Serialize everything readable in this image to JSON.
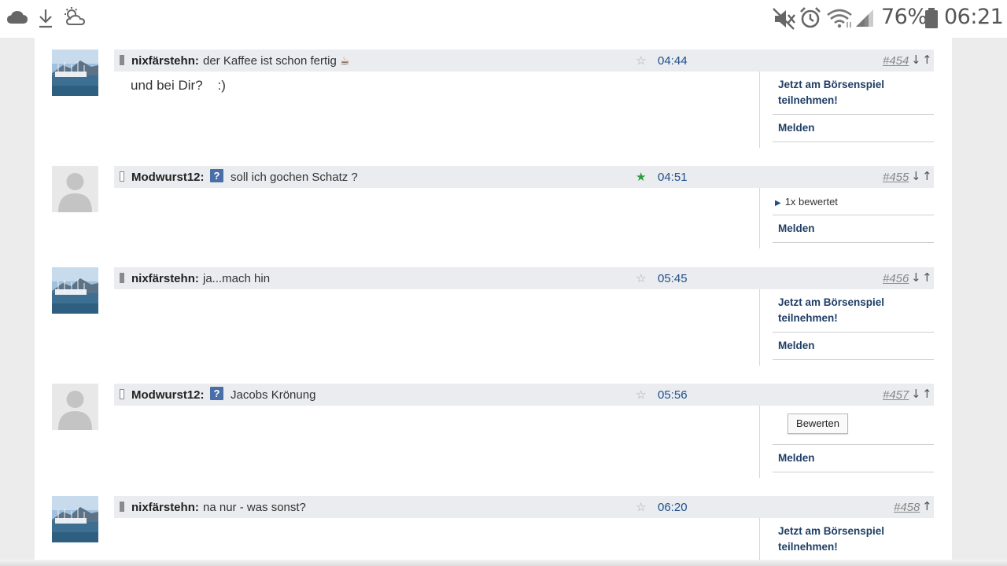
{
  "statusbar": {
    "icons_left": [
      "cloud-icon",
      "download-icon",
      "weather-icon"
    ],
    "icons_right": [
      "mute-icon",
      "alarm-icon",
      "wifi-icon",
      "signal-icon",
      "battery-icon"
    ],
    "battery": "76%",
    "time": "06:21"
  },
  "side": {
    "boerse_line1": "Jetzt am Börsenspiel",
    "boerse_line2": "teilnehmen!",
    "melden": "Melden",
    "rated": "1x bewertet",
    "bewerten": "Bewerten"
  },
  "arrows": {
    "down": "↓",
    "up": "↑"
  },
  "posts": [
    {
      "author": "nixfärstehn:",
      "text": "der Kaffee ist schon fertig",
      "emoji": "☕",
      "time": "04:44",
      "number": "#454",
      "body": "und bei Dir?    :)",
      "starred": false
    },
    {
      "author": "Modwurst12:",
      "badge": "?",
      "text": "soll ich gochen Schatz ?",
      "time": "04:51",
      "number": "#455",
      "starred": true
    },
    {
      "author": "nixfärstehn:",
      "text": "ja...mach hin",
      "time": "05:45",
      "number": "#456",
      "starred": false
    },
    {
      "author": "Modwurst12:",
      "badge": "?",
      "text": "Jacobs Krönung",
      "time": "05:56",
      "number": "#457",
      "starred": false
    },
    {
      "author": "nixfärstehn:",
      "text": "na nur - was sonst?",
      "time": "06:20",
      "number": "#458",
      "starred": false
    }
  ],
  "star_empty": "☆",
  "star_full": "★"
}
